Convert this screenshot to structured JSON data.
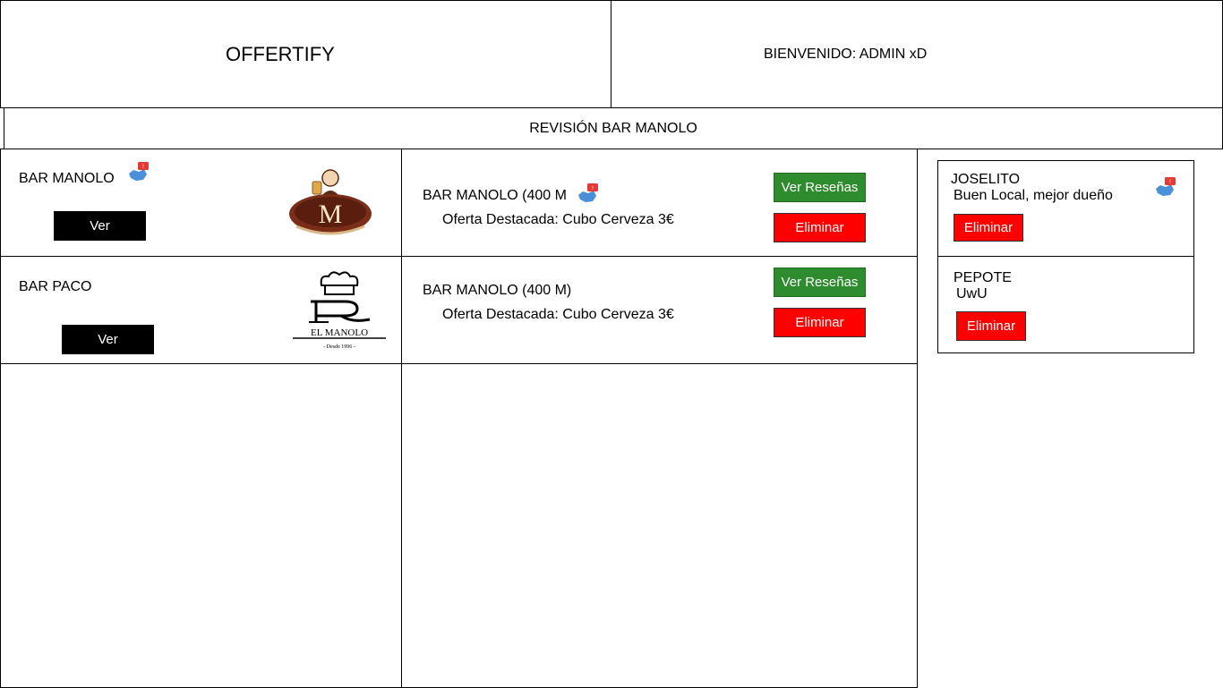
{
  "header": {
    "app_title": "OFFERTIFY",
    "welcome": "BIENVENIDO: ADMIN xD"
  },
  "subheader": {
    "title": "REVISIÓN BAR MANOLO"
  },
  "bars": [
    {
      "name": "BAR MANOLO",
      "button": "Ver",
      "logo_letter": "M",
      "icon": "notification-icon"
    },
    {
      "name": "BAR PACO",
      "button": "Ver",
      "logo_text": "EL MANOLO",
      "logo_sub": "- Desde 1996 -"
    }
  ],
  "offers": [
    {
      "title": "BAR MANOLO (400 M",
      "highlight": "Oferta Destacada: Cubo Cerveza 3€",
      "reviews_button": "Ver Reseñas",
      "delete_button": "Eliminar",
      "icon": "notification-icon"
    },
    {
      "title": "BAR MANOLO (400 M)",
      "highlight": "Oferta Destacada: Cubo Cerveza 3€",
      "reviews_button": "Ver Reseñas",
      "delete_button": "Eliminar"
    }
  ],
  "reviews": [
    {
      "author": "JOSELITO",
      "text": "Buen Local, mejor dueño",
      "delete_button": "Eliminar",
      "icon": "notification-icon"
    },
    {
      "author": "PEPOTE",
      "text": "UwU",
      "delete_button": "Eliminar"
    }
  ],
  "colors": {
    "green_button": "#2e8b2e",
    "red_button": "#ff0000",
    "black_button": "#000000",
    "notification_badge": "#e53935",
    "notification_icon": "#4a90d9"
  }
}
